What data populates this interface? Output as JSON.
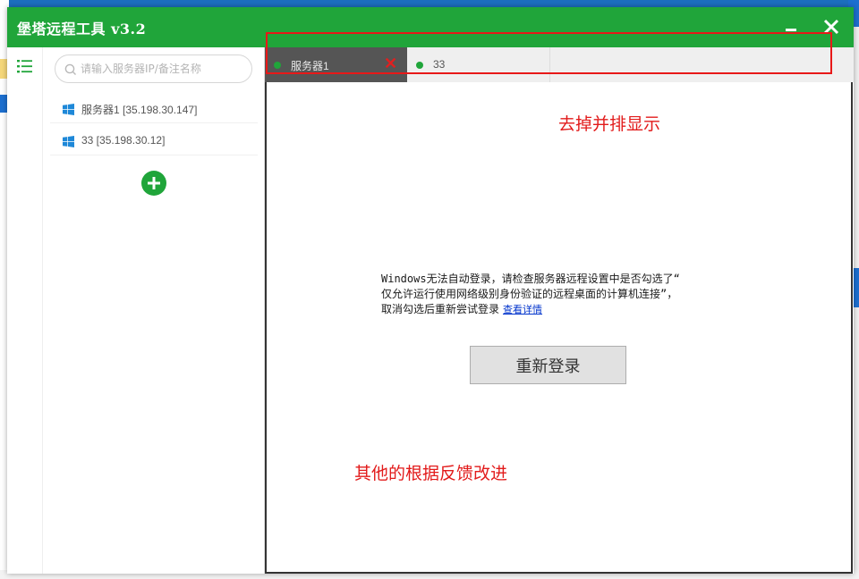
{
  "window": {
    "title": "堡塔远程工具 v3.2",
    "minimize_glyph": "—",
    "close_glyph": "✕"
  },
  "sidebar": {
    "menu_icon": "list-icon",
    "search_placeholder": "请输入服务器IP/备注名称",
    "servers": [
      {
        "label": "服务器1 [35.198.30.147]",
        "icon": "windows-icon"
      },
      {
        "label": "33 [35.198.30.12]",
        "icon": "windows-icon"
      }
    ],
    "add_glyph": "+"
  },
  "tabs": [
    {
      "label": "服务器1",
      "active": true,
      "status_color": "#20a53a",
      "close_glyph": "✕"
    },
    {
      "label": "33",
      "active": false,
      "status_color": "#20a53a"
    }
  ],
  "content": {
    "message_lines": [
      "Windows无法自动登录，请检查服务器远程设置中是否勾选了“",
      "仅允许运行使用网络级别身份验证的远程桌面的计算机连接”，",
      "取消勾选后重新尝试登录"
    ],
    "details_link": "查看详情",
    "relogin_button": "重新登录"
  },
  "annotations": {
    "tabs_note": "去掉并排显示",
    "feedback_note": "其他的根据反馈改进"
  },
  "colors": {
    "brand_green": "#20a53a",
    "annotation_red": "#e21b1b",
    "active_tab": "#555555"
  }
}
